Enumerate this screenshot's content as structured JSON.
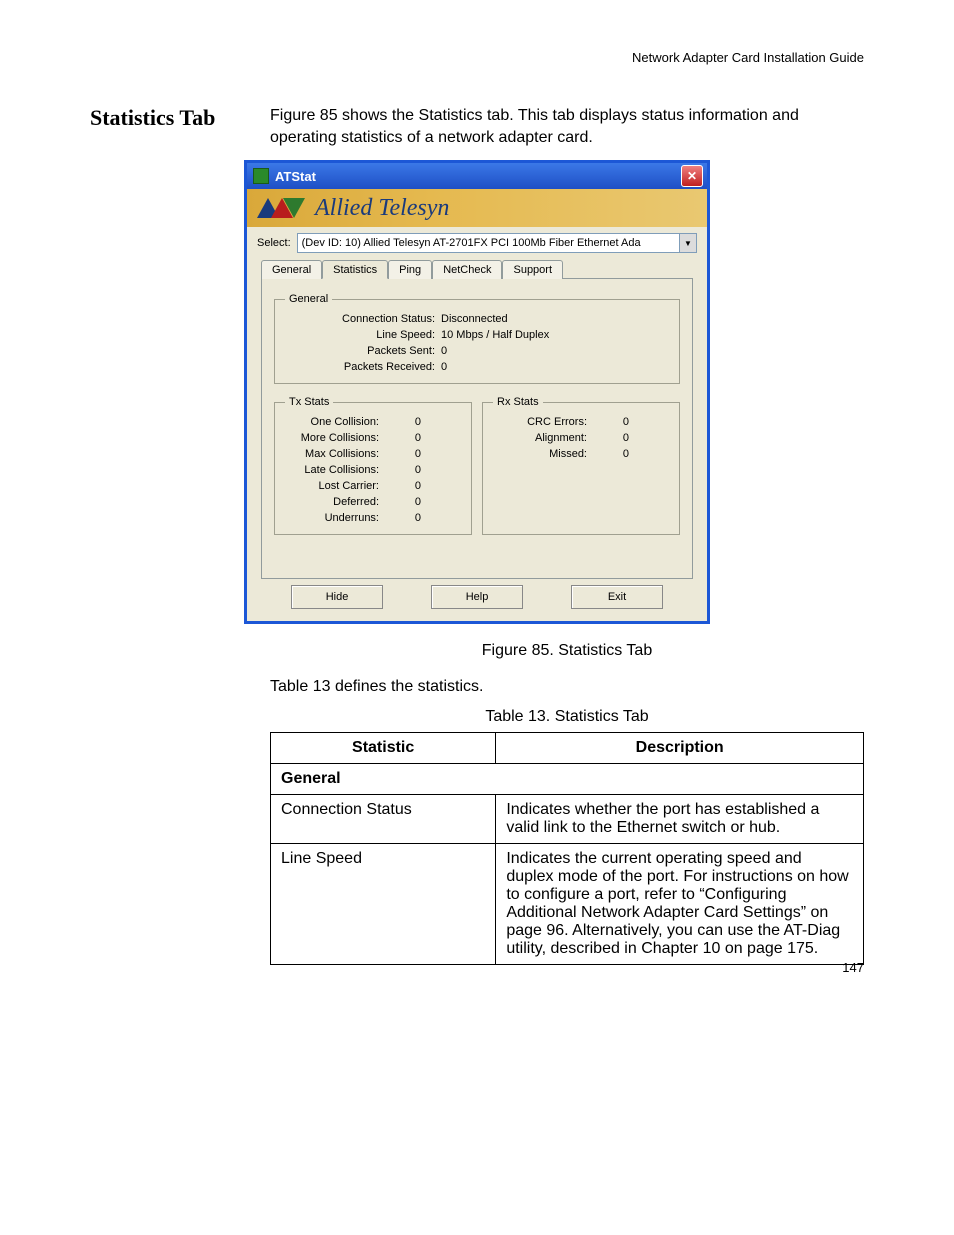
{
  "header": {
    "doc_title": "Network Adapter Card Installation Guide"
  },
  "section": {
    "title": "Statistics Tab"
  },
  "intro_para": "Figure 85 shows the Statistics tab. This tab displays status information and operating statistics of a network adapter card.",
  "atstat": {
    "title": "ATStat",
    "brand": "Allied Telesyn",
    "select_label": "Select:",
    "dropdown_value": "(Dev ID: 10) Allied Telesyn AT-2701FX PCI 100Mb Fiber Ethernet Ada",
    "tabs": [
      "General",
      "Statistics",
      "Ping",
      "NetCheck",
      "Support"
    ],
    "general": {
      "legend": "General",
      "rows": [
        {
          "label": "Connection Status:",
          "value": "Disconnected"
        },
        {
          "label": "Line Speed:",
          "value": "10 Mbps / Half Duplex"
        },
        {
          "label": "Packets Sent:",
          "value": "0"
        },
        {
          "label": "Packets Received:",
          "value": "0"
        }
      ]
    },
    "tx": {
      "legend": "Tx Stats",
      "rows": [
        {
          "label": "One Collision:",
          "value": "0"
        },
        {
          "label": "More Collisions:",
          "value": "0"
        },
        {
          "label": "Max Collisions:",
          "value": "0"
        },
        {
          "label": "Late Collisions:",
          "value": "0"
        },
        {
          "label": "Lost Carrier:",
          "value": "0"
        },
        {
          "label": "Deferred:",
          "value": "0"
        },
        {
          "label": "Underruns:",
          "value": "0"
        }
      ]
    },
    "rx": {
      "legend": "Rx Stats",
      "rows": [
        {
          "label": "CRC Errors:",
          "value": "0"
        },
        {
          "label": "Alignment:",
          "value": "0"
        },
        {
          "label": "Missed:",
          "value": "0"
        }
      ]
    },
    "buttons": {
      "hide": "Hide",
      "help": "Help",
      "exit": "Exit"
    }
  },
  "figure_caption": "Figure 85. Statistics Tab",
  "table_intro": "Table 13 defines the statistics.",
  "table_caption": "Table 13. Statistics Tab",
  "table": {
    "headers": [
      "Statistic",
      "Description"
    ],
    "group": "General",
    "rows": [
      {
        "stat": "Connection Status",
        "desc": "Indicates whether the port has established a valid link to the Ethernet switch or hub."
      },
      {
        "stat": "Line Speed",
        "desc": "Indicates the current operating speed and duplex mode of the port. For instructions on how to configure a port, refer to “Configuring Additional Network Adapter Card Settings” on page 96. Alternatively, you can use the AT-Diag utility, described in Chapter 10 on page 175."
      }
    ]
  },
  "page_number": "147"
}
